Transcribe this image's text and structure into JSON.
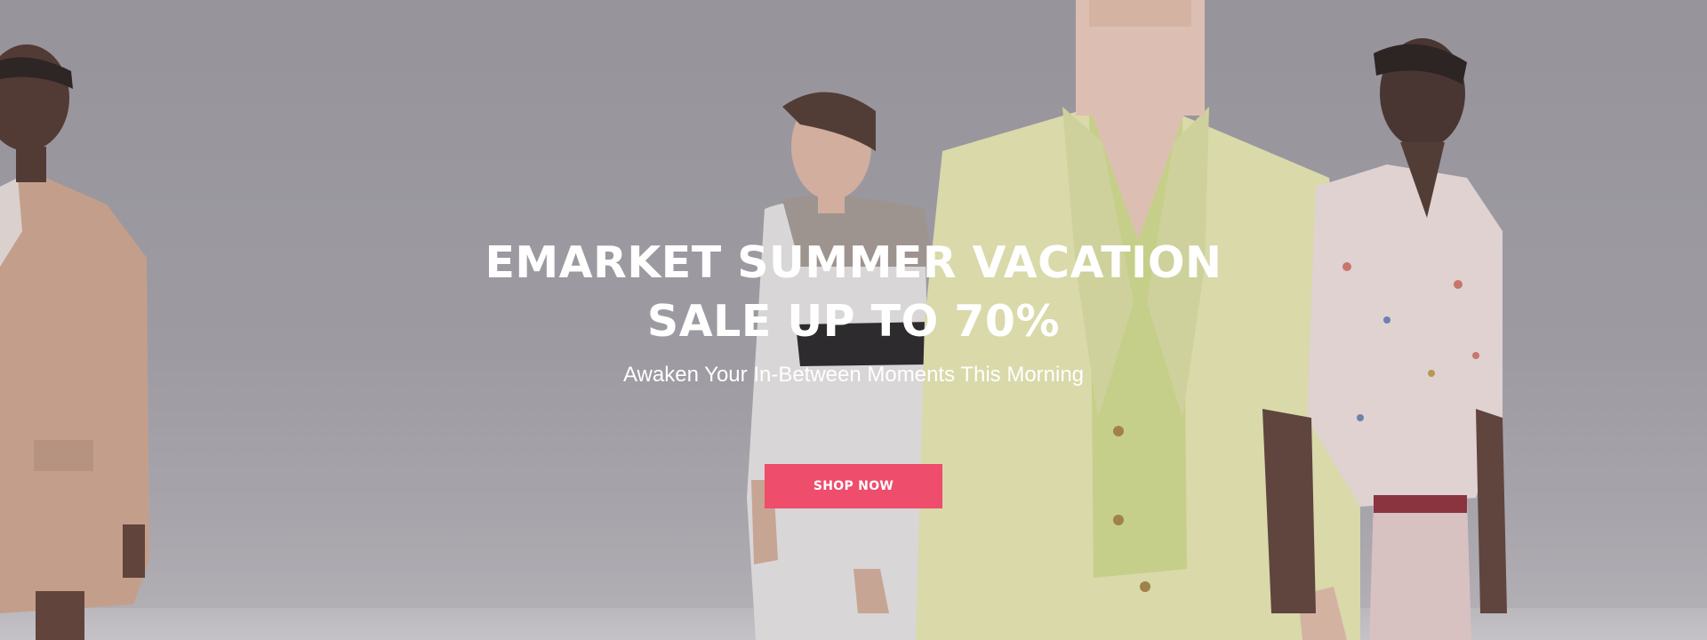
{
  "hero": {
    "headline_line1": "EMARKET SUMMER VACATION",
    "headline_line2": "SALE UP TO 70%",
    "subheadline": "Awaken Your In-Between Moments This Morning",
    "cta_label": "SHOP NOW"
  },
  "colors": {
    "background": "#a29fa6",
    "cta": "#ee4d6c",
    "text": "#ffffff"
  }
}
